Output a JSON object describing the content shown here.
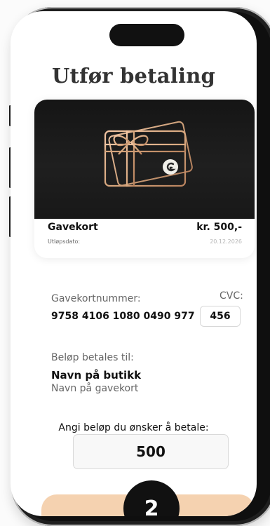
{
  "screen": {
    "title": "Utfør betaling"
  },
  "card": {
    "name": "Gavekort",
    "price": "kr. 500,-",
    "expiry_label": "Utløpsdato:",
    "expiry_value": "20.12.2026"
  },
  "payment": {
    "gift_card_number_label": "Gavekortnummer:",
    "gift_card_number": "9758 4106 1080 0490 977",
    "cvc_label": "CVC:",
    "cvc_value": "456",
    "pay_to_label": "Beløp betales til:",
    "store_name": "Navn på butikk",
    "gift_card_name": "Navn på gavekort",
    "amount_label": "Angi beløp du ønsker å betale:",
    "amount_value": "500"
  },
  "bottom": {
    "badge_text": "2"
  },
  "colors": {
    "frame": "#1f1f1f",
    "card_background": "#1b1b1b",
    "gold": "#d8a87f",
    "accent": "#f5d2b0",
    "text_primary": "#111111",
    "text_secondary": "#666666"
  },
  "icons": {
    "gift_card_icon": "gift-card-icon",
    "brand_logo_icon": "g-logo-icon"
  }
}
